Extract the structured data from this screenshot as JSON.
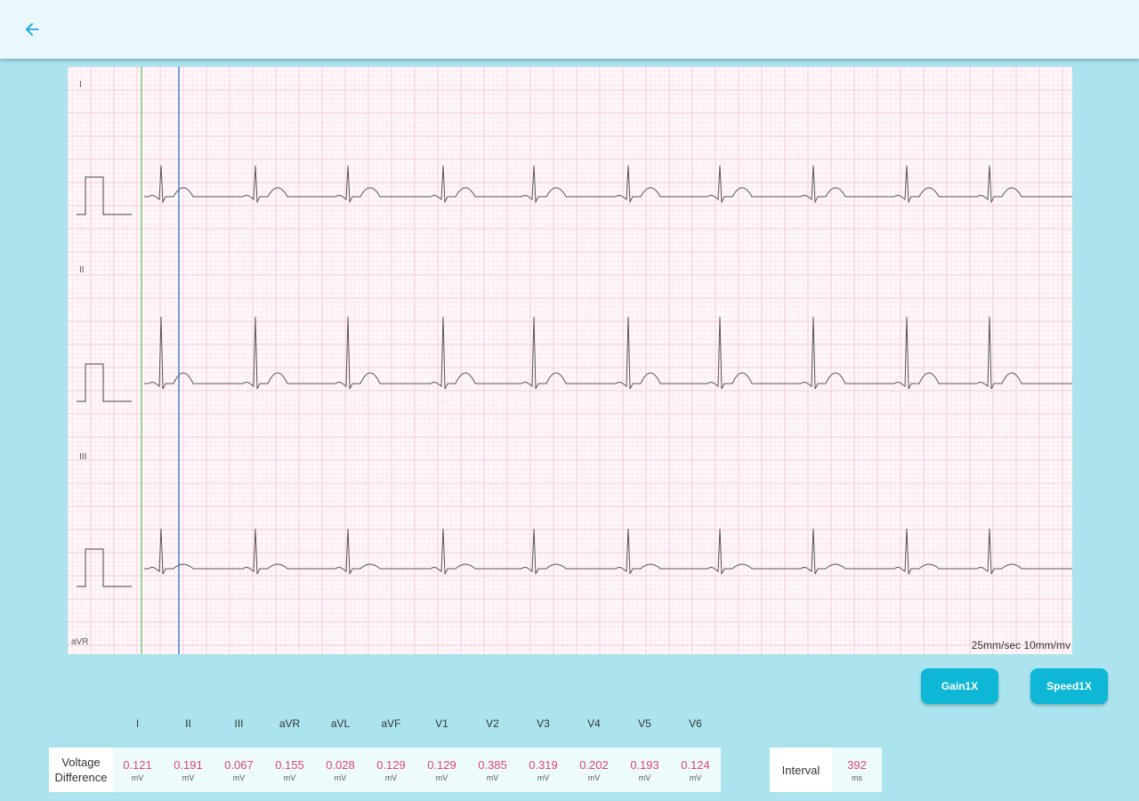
{
  "topbar": {
    "back_icon": "arrow-left-icon",
    "accent": "#1aa6e0"
  },
  "ecg": {
    "leads": [
      {
        "name": "I",
        "qrs_mv": 0.35,
        "t_mv": 0.1
      },
      {
        "name": "II",
        "qrs_mv": 0.75,
        "t_mv": 0.12
      },
      {
        "name": "III",
        "qrs_mv": 0.45,
        "t_mv": 0.05
      },
      {
        "name": "aVR"
      }
    ],
    "scale_text": "25mm/sec 10mm/mv",
    "grid_color": "#f7bfd0",
    "trace_color": "#555555",
    "cursor_green": "#7cc47a",
    "cursor_blue": "#4a7fc8"
  },
  "controls": {
    "gain_label": "Gain1X",
    "speed_label": "Speed1X"
  },
  "voltage": {
    "label_line1": "Voltage",
    "label_line2": "Difference",
    "unit": "mV",
    "leads": [
      {
        "name": "I",
        "value": "0.121"
      },
      {
        "name": "II",
        "value": "0.191"
      },
      {
        "name": "III",
        "value": "0.067"
      },
      {
        "name": "aVR",
        "value": "0.155"
      },
      {
        "name": "aVL",
        "value": "0.028"
      },
      {
        "name": "aVF",
        "value": "0.129"
      },
      {
        "name": "V1",
        "value": "0.129"
      },
      {
        "name": "V2",
        "value": "0.385"
      },
      {
        "name": "V3",
        "value": "0.319"
      },
      {
        "name": "V4",
        "value": "0.202"
      },
      {
        "name": "V5",
        "value": "0.193"
      },
      {
        "name": "V6",
        "value": "0.124"
      }
    ]
  },
  "interval": {
    "label": "Interval",
    "value": "392",
    "unit": "ms"
  }
}
